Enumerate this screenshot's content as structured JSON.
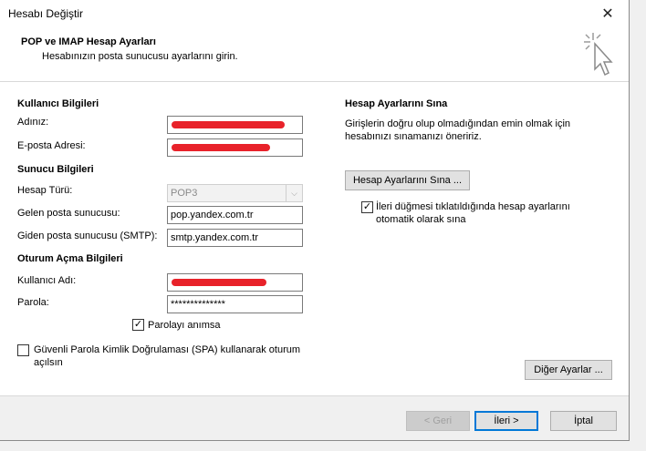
{
  "window": {
    "title": "Hesabı Değiştir"
  },
  "header": {
    "title": "POP ve IMAP Hesap Ayarları",
    "subtitle": "Hesabınızın posta sunucusu ayarlarını girin."
  },
  "user_info": {
    "section": "Kullanıcı Bilgileri",
    "name_label": "Adınız:",
    "name_value": "",
    "email_label": "E-posta Adresi:",
    "email_value": ""
  },
  "server_info": {
    "section": "Sunucu Bilgileri",
    "account_type_label": "Hesap Türü:",
    "account_type_value": "POP3",
    "incoming_label": "Gelen posta sunucusu:",
    "incoming_value": "pop.yandex.com.tr",
    "outgoing_label": "Giden posta sunucusu (SMTP):",
    "outgoing_value": "smtp.yandex.com.tr"
  },
  "logon_info": {
    "section": "Oturum Açma Bilgileri",
    "username_label": "Kullanıcı Adı:",
    "username_value": "",
    "password_label": "Parola:",
    "password_value": "**************",
    "remember_label": "Parolayı anımsa",
    "spa_label_line1": "Güvenli Parola Kimlik Doğrulaması (SPA) kullanarak oturum",
    "spa_label_line2": "açılsın"
  },
  "test": {
    "section": "Hesap Ayarlarını Sına",
    "desc_line1": "Girişlerin doğru olup olmadığından emin olmak için",
    "desc_line2": "hesabınızı sınamanızı öneririz.",
    "test_button": "Hesap Ayarlarını Sına ...",
    "auto_test_line1": "İleri düğmesi tıklatıldığında hesap ayarlarını",
    "auto_test_line2": "otomatik olarak sına"
  },
  "more_settings_button": "Diğer Ayarlar ...",
  "footer": {
    "back": "< Geri",
    "next": "İleri >",
    "cancel": "İptal"
  },
  "checks": {
    "mark": "✓"
  },
  "icons": {
    "close": "✕",
    "dropdown": "⌵"
  }
}
